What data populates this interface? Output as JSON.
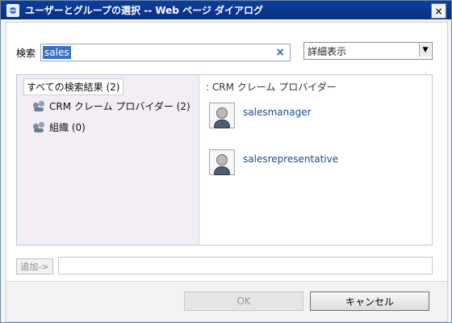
{
  "window": {
    "title": "ユーザーとグループの選択 -- Web ページ ダイアログ"
  },
  "search": {
    "label": "検索",
    "value": "sales",
    "clear_symbol": "×"
  },
  "view": {
    "selected": "詳細表示"
  },
  "left_tree": {
    "root": "すべての検索結果 (2)",
    "items": [
      {
        "label": "CRM クレーム プロバイダー (2)",
        "icon": "group-icon"
      },
      {
        "label": "組織 (0)",
        "icon": "group-icon"
      }
    ]
  },
  "right_panel": {
    "header": ": CRM クレーム プロバイダー",
    "users": [
      {
        "name": "salesmanager",
        "icon": "user-icon"
      },
      {
        "name": "salesrepresentative",
        "icon": "user-icon"
      }
    ]
  },
  "actions": {
    "add_label": "追加->"
  },
  "footer": {
    "ok_label": "OK",
    "cancel_label": "キャンセル"
  },
  "misc": {
    "tiny_mark": "·"
  }
}
